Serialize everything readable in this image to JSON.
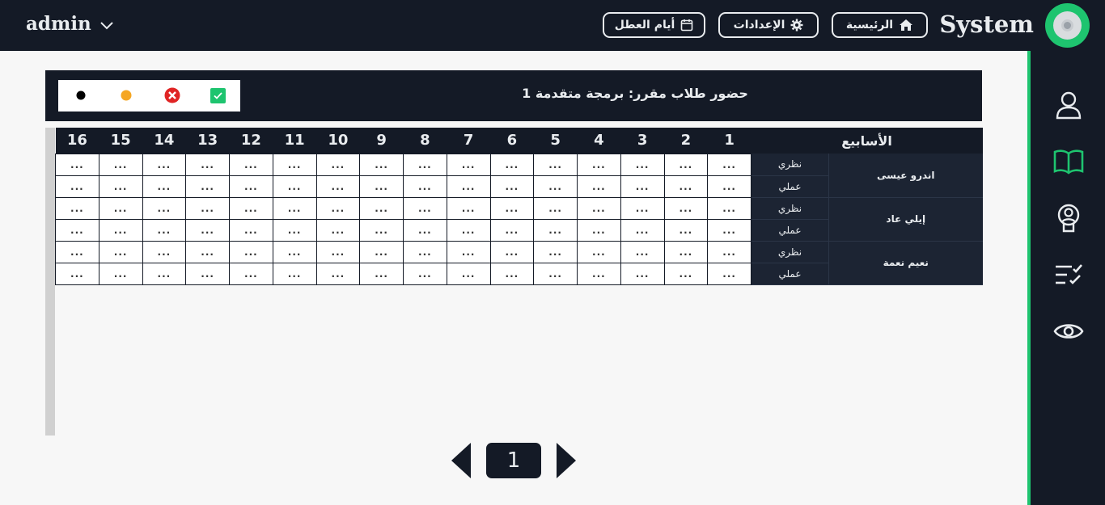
{
  "topbar": {
    "user_name": "admin",
    "brand": "System",
    "nav": [
      {
        "label": "الرئيسية",
        "icon": "home-icon"
      },
      {
        "label": "الإعدادات",
        "icon": "gear-icon"
      },
      {
        "label": "أيام العطل",
        "icon": "calendar-icon"
      }
    ]
  },
  "sidebar": {
    "items": [
      {
        "icon": "user-icon"
      },
      {
        "icon": "book-icon",
        "active": true
      },
      {
        "icon": "badge-icon"
      },
      {
        "icon": "checklist-icon"
      },
      {
        "icon": "eye-icon"
      }
    ]
  },
  "course": {
    "title": "حضور طلاب مقرر: برمجة متقدمة 1"
  },
  "legend": [
    {
      "status": "present",
      "color": "#1ec46f",
      "icon": "check-icon"
    },
    {
      "status": "absent",
      "color": "#e02424",
      "icon": "x-circle-icon"
    },
    {
      "status": "late",
      "color": "#f5a623",
      "icon": "orange-dot-icon"
    },
    {
      "status": "none",
      "color": "#000000",
      "icon": "black-dot-icon"
    }
  ],
  "table": {
    "weeks_label": "الأسابيع",
    "weeks": [
      "1",
      "2",
      "3",
      "4",
      "5",
      "6",
      "7",
      "8",
      "9",
      "10",
      "11",
      "12",
      "13",
      "14",
      "15",
      "16"
    ],
    "cell_value": "...",
    "students": [
      {
        "name": "اندرو عيسى",
        "rows": [
          {
            "type": "نظري"
          },
          {
            "type": "عملي"
          }
        ]
      },
      {
        "name": "إيلي عاد",
        "rows": [
          {
            "type": "نظري"
          },
          {
            "type": "عملي"
          }
        ]
      },
      {
        "name": "نعيم نعمة",
        "rows": [
          {
            "type": "نظري"
          },
          {
            "type": "عملي"
          }
        ]
      }
    ]
  },
  "pagination": {
    "current_page": "1"
  },
  "colors": {
    "dark": "#141a26",
    "accent": "#1ec46f",
    "background": "#f7f7f7"
  }
}
